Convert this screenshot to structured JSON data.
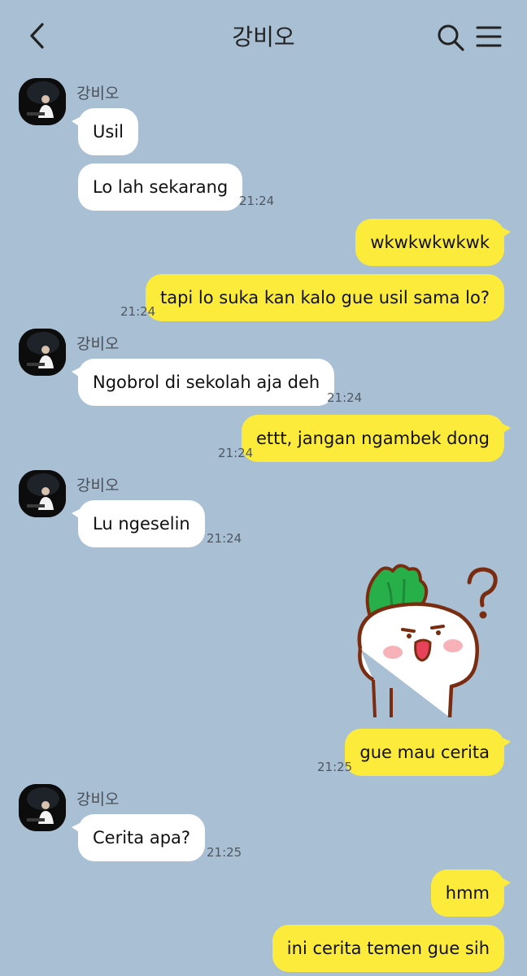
{
  "header": {
    "title": "강비오",
    "back_icon": "chevron-left-icon",
    "search_icon": "search-icon",
    "menu_icon": "menu-icon"
  },
  "contact": {
    "name": "강비오"
  },
  "messages": [
    {
      "text": "Usil"
    },
    {
      "text": "Lo lah sekarang",
      "time": "21:24"
    },
    {
      "text": "wkwkwkwkwk"
    },
    {
      "text": "tapi lo suka kan kalo gue usil sama lo?",
      "time": "21:24"
    },
    {
      "text": "Ngobrol di sekolah aja deh",
      "time": "21:24"
    },
    {
      "text": "ettt, jangan ngambek dong",
      "time": "21:24"
    },
    {
      "text": "Lu ngeselin",
      "time": "21:24"
    },
    {
      "sticker": "radish-question-sticker"
    },
    {
      "text": "gue mau cerita",
      "time": "21:25"
    },
    {
      "text": "Cerita apa?",
      "time": "21:25"
    },
    {
      "text": "hmm"
    },
    {
      "text": "ini cerita temen gue sih"
    }
  ],
  "colors": {
    "background": "#a9bfd4",
    "incoming_bubble": "#ffffff",
    "outgoing_bubble": "#fdeb3c"
  }
}
